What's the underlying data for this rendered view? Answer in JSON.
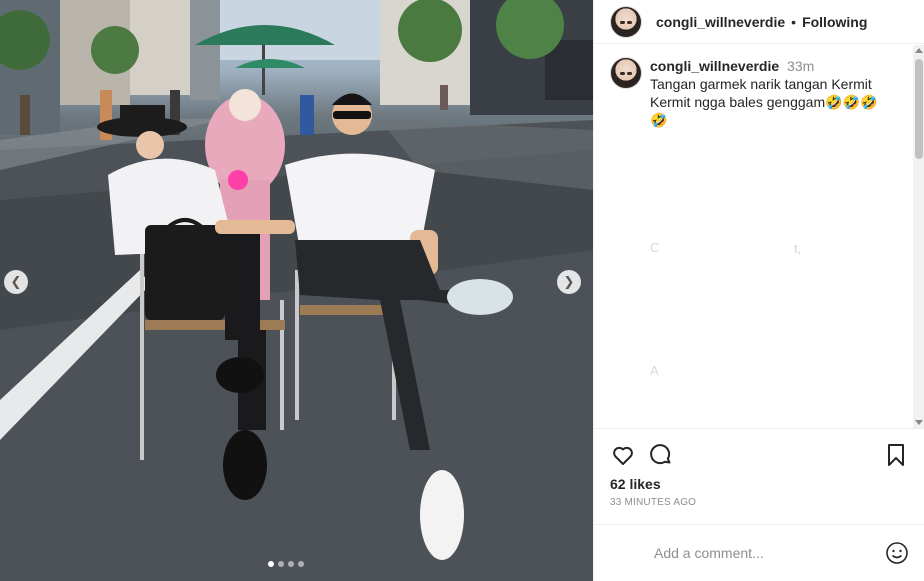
{
  "post": {
    "username": "congli_willneverdie",
    "separator": "•",
    "follow_status": "Following",
    "caption_username": "congli_willneverdie",
    "caption_time": "33m",
    "caption_text": "Tangan garmek narik tangan Kermit Kermit ngga bales genggam🤣🤣🤣🤣",
    "faded_lines": [
      "C",
      "t,",
      "A"
    ],
    "likes": "62 likes",
    "time_ago": "33 MINUTES AGO",
    "comment_placeholder": "Add a comment..."
  },
  "icons": {
    "like": "heart-icon",
    "comment": "comment-icon",
    "save": "bookmark-icon",
    "emoji": "smiley-icon",
    "prev": "chevron-left-icon",
    "next": "chevron-right-icon"
  },
  "carousel": {
    "slides": 4,
    "active": 1
  },
  "colors": {
    "text": "#262626",
    "muted": "#8e8e8e",
    "border": "#efefef"
  }
}
